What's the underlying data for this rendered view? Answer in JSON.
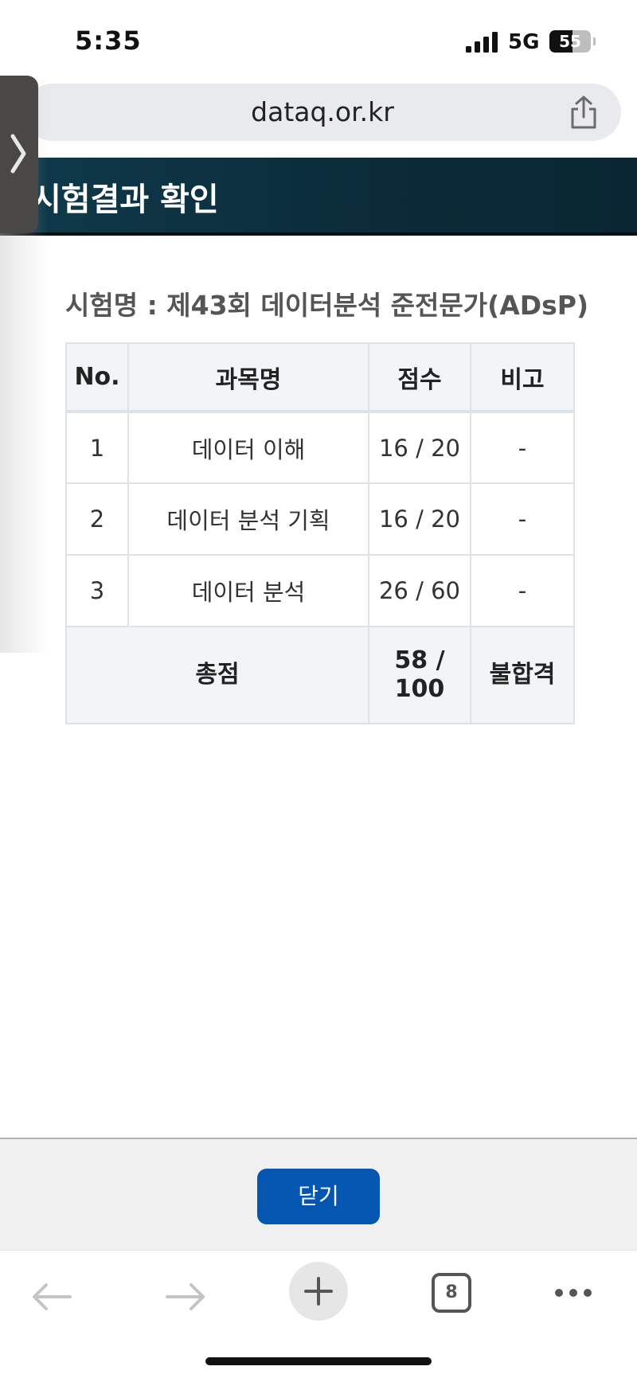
{
  "status_bar": {
    "time": "5:35",
    "network": "5G",
    "battery_percent": 55,
    "battery_label": "55"
  },
  "browser": {
    "url": "dataq.or.kr",
    "share_icon": "share-icon",
    "tab_count": "8"
  },
  "page": {
    "header_title": "시험결과 확인",
    "exam_name": "시험명 : 제43회 데이터분석 준전문가(ADsP)",
    "table": {
      "headers": [
        "No.",
        "과목명",
        "점수",
        "비고"
      ],
      "rows": [
        {
          "no": "1",
          "subject": "데이터 이해",
          "score": "16 / 20",
          "note": "-"
        },
        {
          "no": "2",
          "subject": "데이터 분석 기획",
          "score": "16 / 20",
          "note": "-"
        },
        {
          "no": "3",
          "subject": "데이터 분석",
          "score": "26 / 60",
          "note": "-"
        }
      ],
      "total": {
        "label": "총점",
        "score_line1": "58 /",
        "score_line2": "100",
        "result": "불합격"
      }
    },
    "close_button": "닫기"
  },
  "colors": {
    "header_bg": "#0b2b38",
    "button_blue": "#0456b0",
    "table_header_bg": "#f2f5f7",
    "table_border": "#dde2e6"
  }
}
